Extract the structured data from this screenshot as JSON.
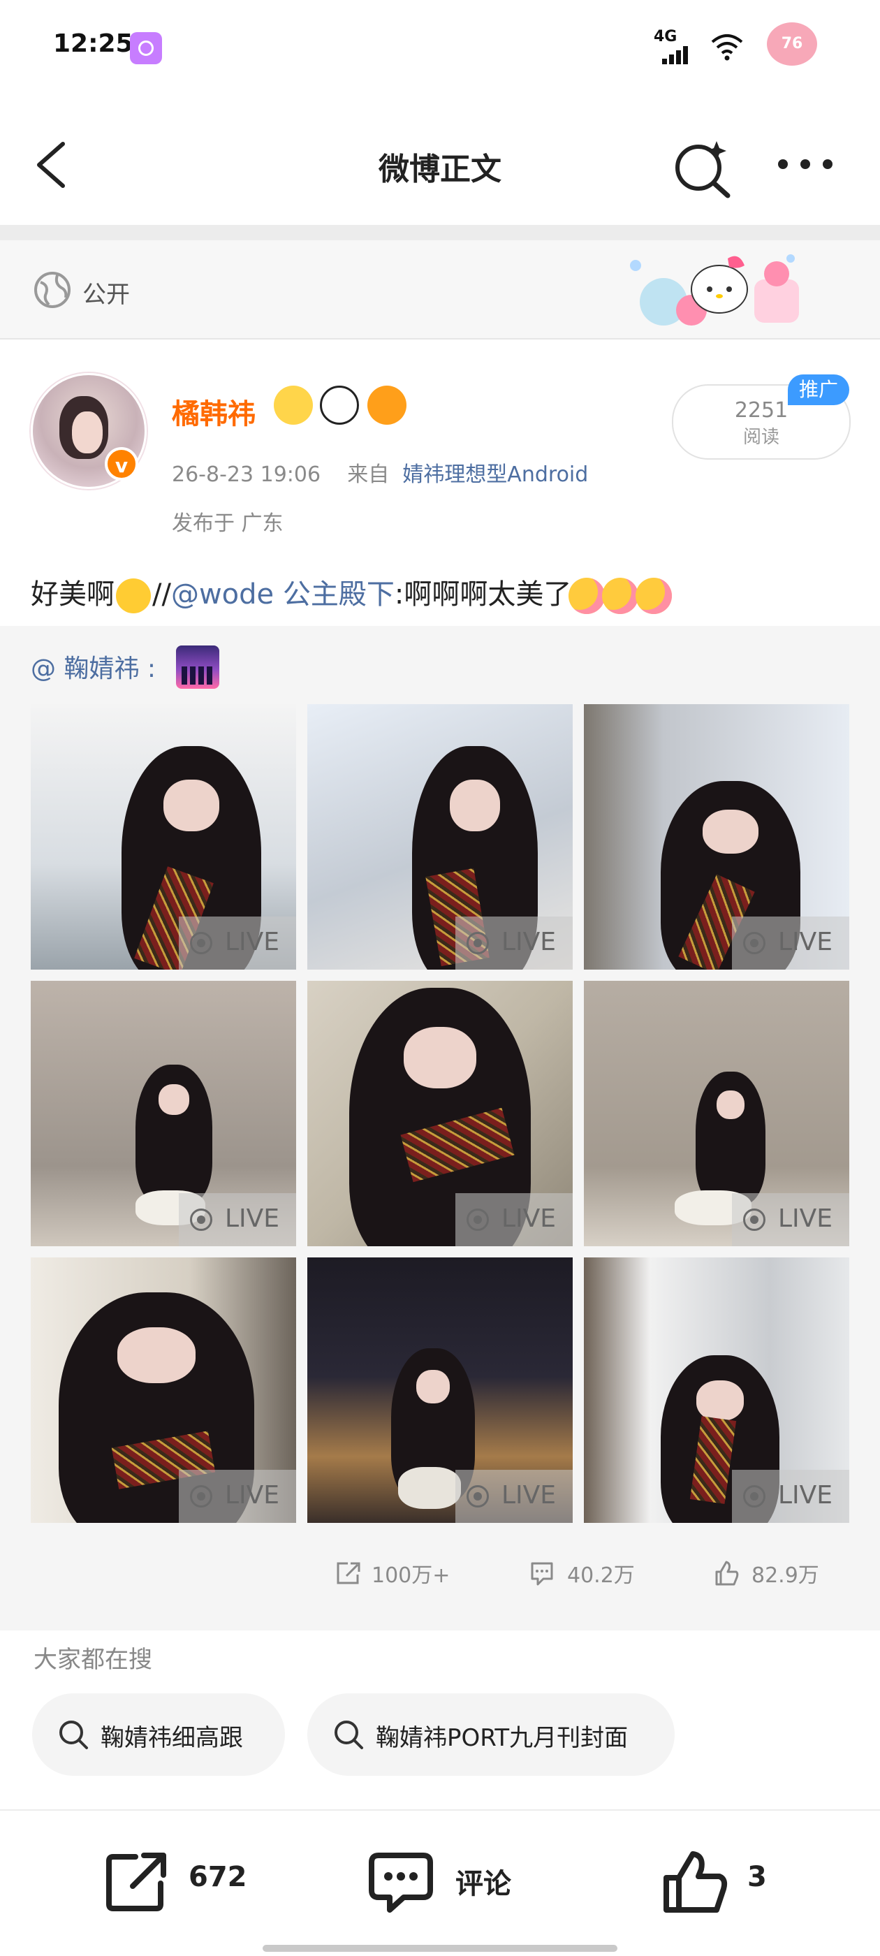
{
  "status_bar": {
    "time": "12:25",
    "network": "4G",
    "battery": "76"
  },
  "nav": {
    "title": "微博正文"
  },
  "visibility": {
    "label": "公开"
  },
  "post": {
    "username": "橘韩祎",
    "verified_badge": "v",
    "time": "26-8-23 19:06",
    "from_label": "来自",
    "source": "婧祎理想型Android",
    "location": "发布于  广东",
    "reads_count": "2251",
    "reads_label": "阅读",
    "promo_badge": "推广",
    "text_before": "好美啊",
    "text_slashes": "//",
    "mention": "@wode 公主殿下",
    "text_after": ":啊啊啊太美了"
  },
  "repost": {
    "origin_user": "@ 鞠婧祎",
    "origin_suffix": ":",
    "live_label": "LIVE",
    "photos_count": 9,
    "stats": {
      "reposts": "100万+",
      "comments": "40.2万",
      "likes": "82.9万"
    }
  },
  "hot_search": {
    "title": "大家都在搜",
    "items": [
      "鞠婧祎细高跟",
      "鞠婧祎PORT九月刊封面"
    ]
  },
  "bottom_bar": {
    "repost_count": "672",
    "comment_label": "评论",
    "like_count": "3"
  },
  "colors": {
    "brand_orange": "#ff8200",
    "link_blue": "#4d6ea1",
    "username": "#ff6a00"
  },
  "icons": [
    "back-icon",
    "search-sparkle-icon",
    "more-icon",
    "globe-icon",
    "repost-icon",
    "comment-icon",
    "like-icon",
    "live-photo-icon"
  ]
}
